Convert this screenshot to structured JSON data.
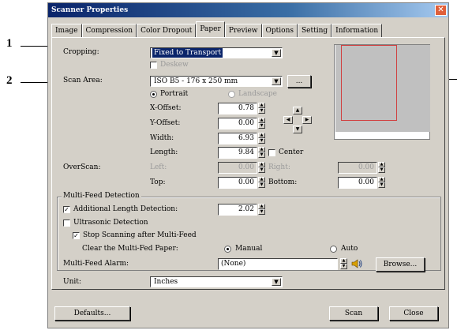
{
  "callouts": [
    "1",
    "2"
  ],
  "window": {
    "title": "Scanner Properties"
  },
  "tabs": [
    "Image",
    "Compression",
    "Color Dropout",
    "Paper",
    "Preview",
    "Options",
    "Setting",
    "Information"
  ],
  "cropping": {
    "label": "Cropping:",
    "value": "Fixed to Transport",
    "deskew_label": "Deskew"
  },
  "scan_area": {
    "label": "Scan Area:",
    "value": "ISO B5 - 176 x 250 mm",
    "more_button": "..."
  },
  "orientation": {
    "portrait": "Portrait",
    "landscape": "Landscape",
    "selected": "Portrait"
  },
  "fields": {
    "x_offset": {
      "label": "X-Offset:",
      "value": "0.78"
    },
    "y_offset": {
      "label": "Y-Offset:",
      "value": "0.00"
    },
    "width": {
      "label": "Width:",
      "value": "6.93"
    },
    "length": {
      "label": "Length:",
      "value": "9.84"
    },
    "center_label": "Center"
  },
  "overscan": {
    "label": "OverScan:",
    "left": {
      "label": "Left:",
      "value": "0.00"
    },
    "right": {
      "label": "Right:",
      "value": "0.00"
    },
    "top": {
      "label": "Top:",
      "value": "0.00"
    },
    "bottom": {
      "label": "Bottom:",
      "value": "0.00"
    }
  },
  "multifeed": {
    "group_title": "Multi-Feed Detection",
    "additional_length": {
      "label": "Additional Length Detection:",
      "value": "2.02",
      "checked": true
    },
    "ultrasonic": {
      "label": "Ultrasonic Detection",
      "checked": false
    },
    "stop_scanning": {
      "label": "Stop Scanning after Multi-Feed",
      "checked": true
    },
    "clear_label": "Clear the Multi-Fed Paper:",
    "manual": "Manual",
    "auto": "Auto",
    "alarm_label": "Multi-Feed Alarm:",
    "alarm_value": "(None)",
    "browse": "Browse..."
  },
  "unit": {
    "label": "Unit:",
    "value": "Inches"
  },
  "footer": {
    "defaults": "Defaults...",
    "scan": "Scan",
    "close": "Close"
  }
}
